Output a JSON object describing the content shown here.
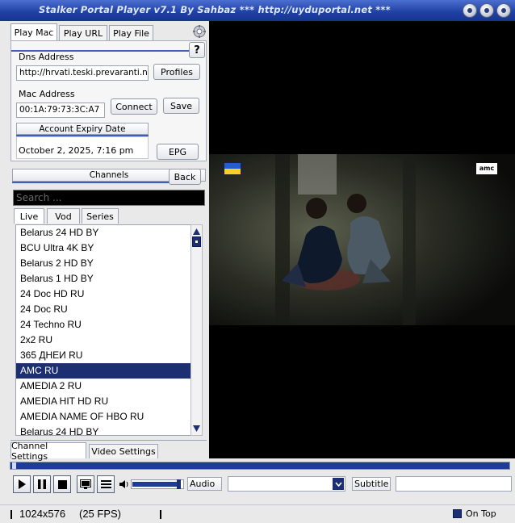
{
  "window": {
    "title": "Stalker Portal Player v7.1 By Sahbaz   *** http://uyduportal.net ***"
  },
  "top_tabs": [
    "Play Mac",
    "Play URL",
    "Play File"
  ],
  "help_label": "?",
  "dns": {
    "label": "Dns Address",
    "value": "http://hrvati.teski.prevaranti.na.",
    "profiles_label": "Profiles"
  },
  "mac": {
    "label": "Mac Address",
    "value": "00:1A:79:73:3C:A7",
    "connect_label": "Connect",
    "save_label": "Save"
  },
  "expiry": {
    "header": "Account Expiry Date",
    "value": "October 2, 2025, 7:16 pm",
    "epg_label": "EPG"
  },
  "channels": {
    "header": "Channels",
    "back_label": "Back",
    "search_placeholder": "Search ...",
    "tabs": [
      "Live",
      "Vod",
      "Series"
    ],
    "items": [
      "Belarus 24 HD BY",
      "BCU Ultra 4K BY",
      "Belarus 2 HD BY",
      "Belarus 1 HD BY",
      "24 Doc HD RU",
      "24 Doc RU",
      "24 Techno RU",
      "2x2 RU",
      "365 ДНЕИ RU",
      "AMC RU",
      "AMEDIA 2 RU",
      "AMEDIA HIT HD RU",
      "AMEDIA NAME OF HBO RU",
      "Belarus 24 HD BY"
    ],
    "selected_index": 9
  },
  "bottom_tabs": [
    "Channel Settings",
    "Video Settings"
  ],
  "video": {
    "channel_logo": "amc",
    "flag": "ukraine-flag"
  },
  "controls": {
    "audio_label": "Audio",
    "audio_value": "",
    "subtitle_label": "Subtitle",
    "subtitle_value": "",
    "volume_level": 0.9
  },
  "status": {
    "resolution": "1024x576",
    "fps": "(25 FPS)",
    "ontop_label": "On Top"
  },
  "colors": {
    "title_bar": "#1f3fa3",
    "selection": "#1c2f73",
    "progress": "#1c3c97"
  }
}
